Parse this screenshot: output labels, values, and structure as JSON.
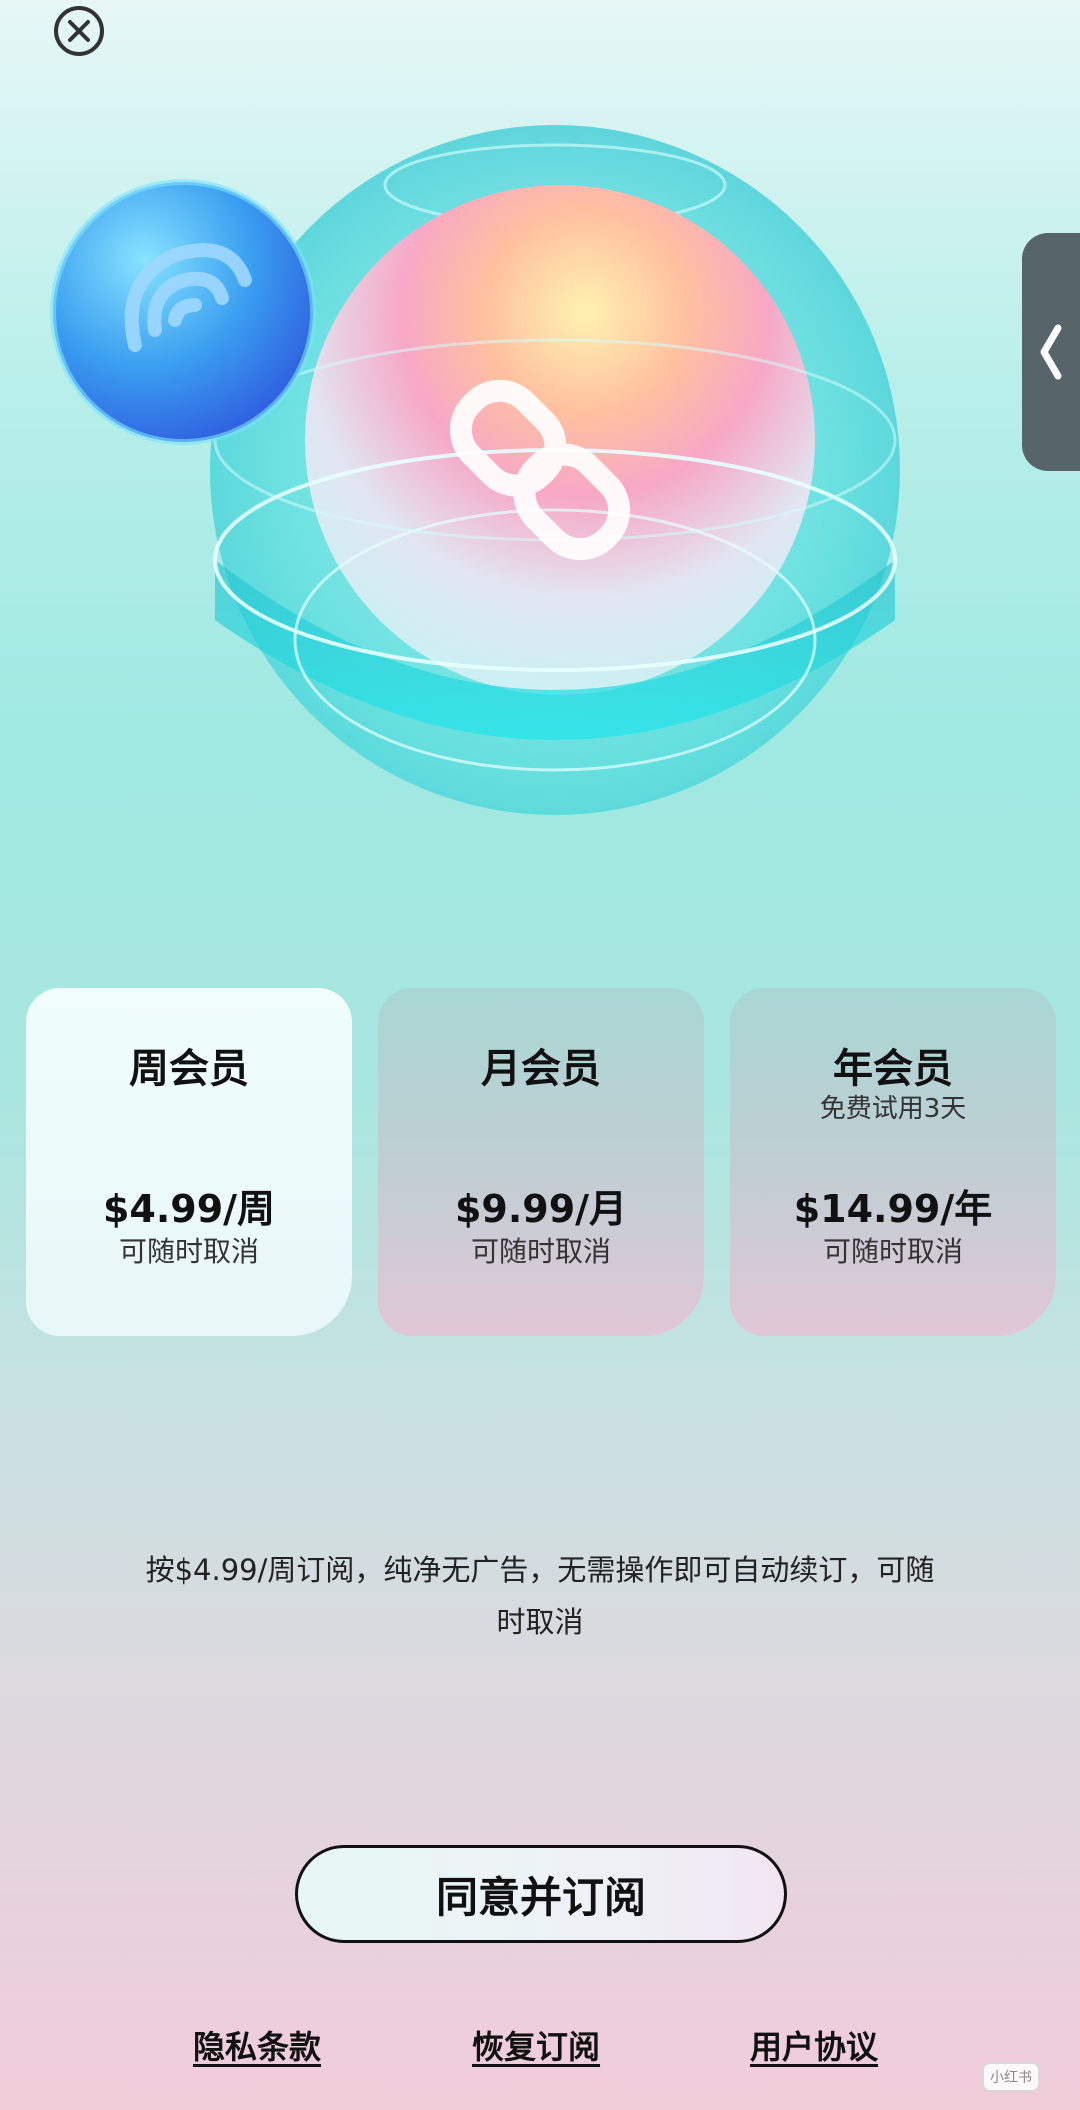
{
  "colors": {
    "accent_teal": "#4fe3df",
    "selected_card": "#eefcfb",
    "text_primary": "#111111",
    "side_tab": "#57646a"
  },
  "icons": {
    "close": "close-icon",
    "back": "chevron-left-icon",
    "hero_logo": "app-logo-icon",
    "badge": "spiral-logo-icon"
  },
  "plans": [
    {
      "title": "周会员",
      "subtitle": "",
      "price": "$4.99/周",
      "note": "可随时取消",
      "selected": true
    },
    {
      "title": "月会员",
      "subtitle": "",
      "price": "$9.99/月",
      "note": "可随时取消",
      "selected": false
    },
    {
      "title": "年会员",
      "subtitle": "免费试用3天",
      "price": "$14.99/年",
      "note": "可随时取消",
      "selected": false
    }
  ],
  "description": {
    "line1": "按$4.99/周订阅，纯净无广告，无需操作即可自动续订，可随",
    "line2": "时取消"
  },
  "subscribe_button": "同意并订阅",
  "footer": {
    "privacy": "隐私条款",
    "restore": "恢复订阅",
    "agreement": "用户协议"
  },
  "watermark": "小红书"
}
